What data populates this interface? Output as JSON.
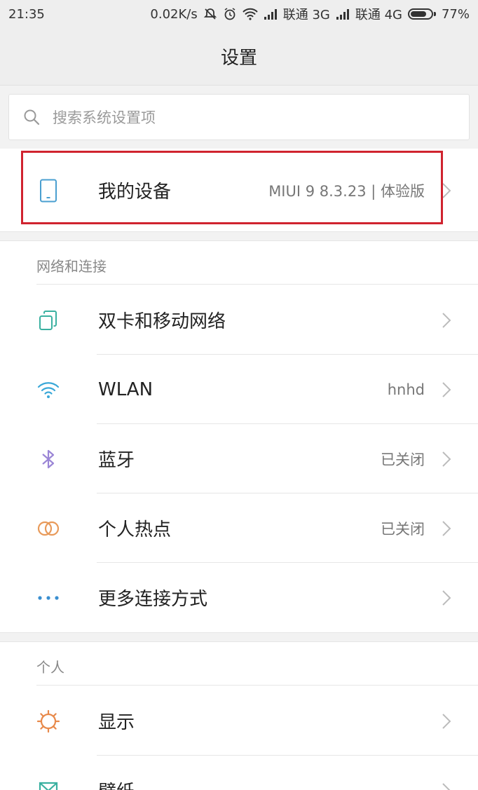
{
  "status_bar": {
    "time": "21:35",
    "speed": "0.02K/s",
    "carrier1": "联通 3G",
    "carrier2": "联通 4G",
    "battery": "77%",
    "battery_level": 0.77
  },
  "header": {
    "title": "设置"
  },
  "search": {
    "placeholder": "搜索系统设置项"
  },
  "device": {
    "label": "我的设备",
    "value": "MIUI 9 8.3.23 | 体验版"
  },
  "sections": [
    {
      "title": "网络和连接",
      "items": [
        {
          "label": "双卡和移动网络",
          "value": ""
        },
        {
          "label": "WLAN",
          "value": "hnhd"
        },
        {
          "label": "蓝牙",
          "value": "已关闭"
        },
        {
          "label": "个人热点",
          "value": "已关闭"
        },
        {
          "label": "更多连接方式",
          "value": ""
        }
      ]
    },
    {
      "title": "个人",
      "items": [
        {
          "label": "显示",
          "value": ""
        },
        {
          "label": "壁纸",
          "value": ""
        }
      ]
    }
  ],
  "colors": {
    "highlight": "#d0232f",
    "icon_device": "#4a9fd0",
    "icon_sim": "#3ab0a0",
    "icon_wifi": "#3aa8d8",
    "icon_bluetooth": "#9b86d6",
    "icon_hotspot": "#e89a5a",
    "icon_more": "#3a8fd0",
    "icon_display": "#e8894a",
    "icon_wallpaper": "#3ab0a0"
  }
}
